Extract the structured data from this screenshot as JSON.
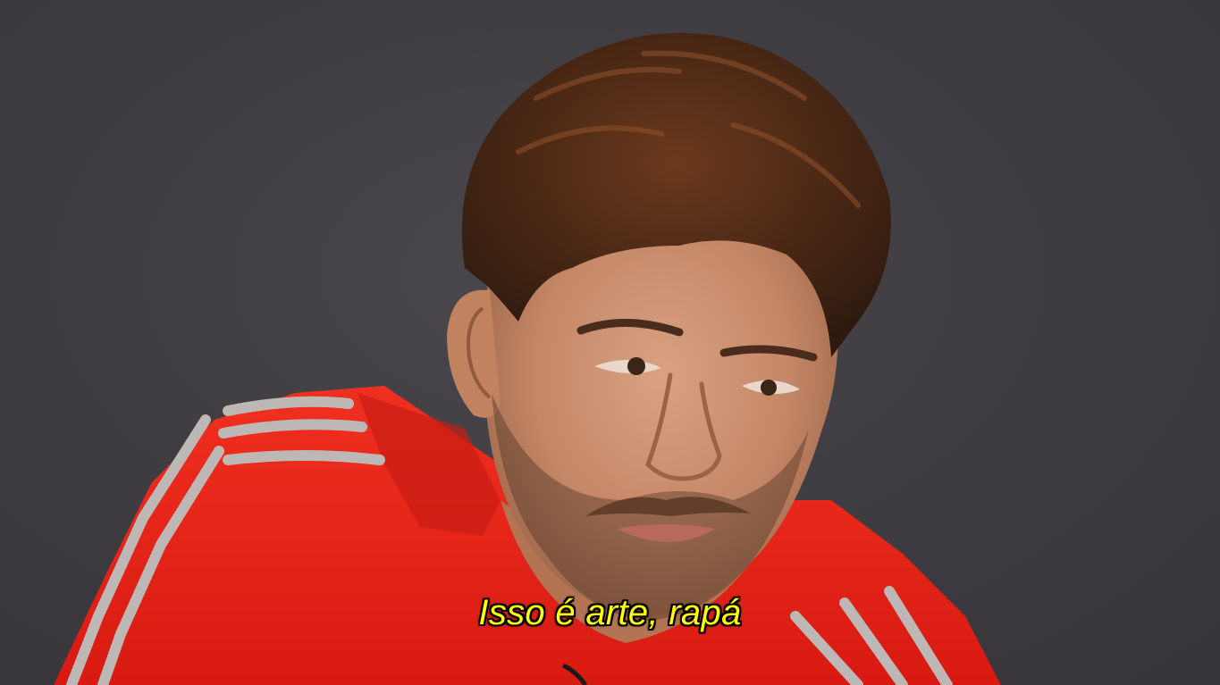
{
  "subtitle": {
    "text": "Isso é arte, rapá",
    "color": "#ffff00"
  },
  "scene": {
    "background_color": "#3f3d41",
    "shirt_color": "#e8231b",
    "stripe_color": "#b9b4b1",
    "skin_color": "#c98f6e",
    "hair_color": "#4a2a18"
  }
}
